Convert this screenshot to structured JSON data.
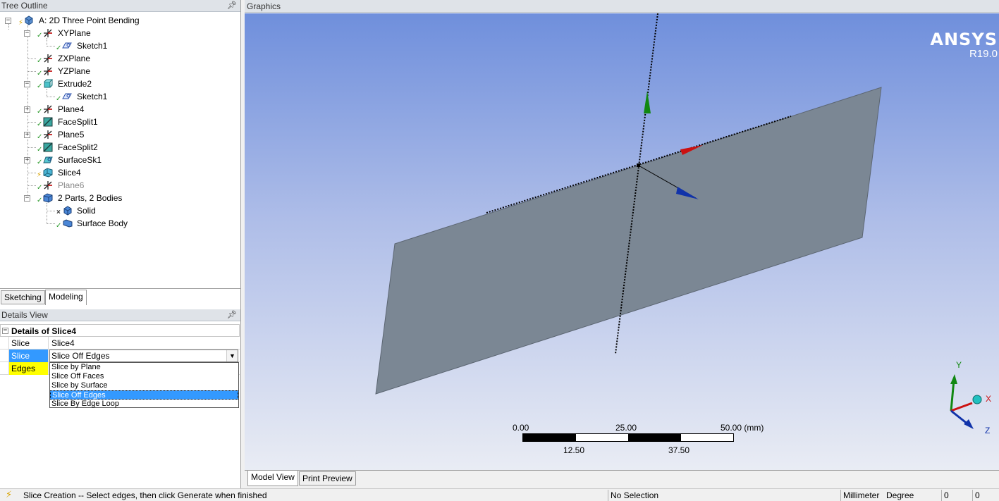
{
  "tree_outline": {
    "title": "Tree Outline",
    "items": [
      {
        "label": "A: 2D Three Point Bending",
        "icon": "model-icon",
        "status": "bolt"
      },
      {
        "label": "XYPlane",
        "icon": "plane-icon",
        "status": "check"
      },
      {
        "label": "Sketch1",
        "icon": "sketch-icon",
        "status": "check"
      },
      {
        "label": "ZXPlane",
        "icon": "plane-icon",
        "status": "check"
      },
      {
        "label": "YZPlane",
        "icon": "plane-icon",
        "status": "check"
      },
      {
        "label": "Extrude2",
        "icon": "extrude-icon",
        "status": "check"
      },
      {
        "label": "Sketch1",
        "icon": "sketch-icon",
        "status": "check"
      },
      {
        "label": "Plane4",
        "icon": "plane-icon",
        "status": "check"
      },
      {
        "label": "FaceSplit1",
        "icon": "facesplit-icon",
        "status": "check"
      },
      {
        "label": "Plane5",
        "icon": "plane-icon",
        "status": "check"
      },
      {
        "label": "FaceSplit2",
        "icon": "facesplit-icon",
        "status": "check"
      },
      {
        "label": "SurfaceSk1",
        "icon": "surface-sketch-icon",
        "status": "check"
      },
      {
        "label": "Slice4",
        "icon": "slice-icon",
        "status": "bolt"
      },
      {
        "label": "Plane6",
        "icon": "plane-icon",
        "status": "check"
      },
      {
        "label": "2 Parts, 2 Bodies",
        "icon": "parts-icon",
        "status": "check"
      },
      {
        "label": "Solid",
        "icon": "solid-body-icon",
        "status": "x"
      },
      {
        "label": "Surface Body",
        "icon": "surface-body-icon",
        "status": "check"
      }
    ]
  },
  "tabs": {
    "sketching": "Sketching",
    "modeling": "Modeling"
  },
  "details_view": {
    "title": "Details View",
    "section": "Details of Slice4",
    "rows": [
      {
        "key": "Slice",
        "value": "Slice4"
      },
      {
        "key": "Slice Type",
        "value": "Slice Off Edges"
      },
      {
        "key": "Edges",
        "value": ""
      }
    ],
    "dropdown_options": [
      "Slice by Plane",
      "Slice Off Faces",
      "Slice by Surface",
      "Slice Off Edges",
      "Slice By Edge Loop"
    ],
    "selected_option": "Slice Off Edges"
  },
  "graphics": {
    "title": "Graphics",
    "brand": "ANSYS",
    "version": "R19.0",
    "triad": {
      "x": "X",
      "y": "Y",
      "z": "Z"
    },
    "scale_bar": {
      "top_labels": [
        "0.00",
        "25.00",
        "50.00 (mm)"
      ],
      "bottom_labels": [
        "12.50",
        "37.50"
      ]
    }
  },
  "view_tabs": {
    "model_view": "Model View",
    "print_preview": "Print Preview"
  },
  "status_bar": {
    "message": "Slice Creation -- Select edges, then click Generate when finished",
    "selection": "No Selection",
    "units_length": "Millimeter",
    "units_angle": "Degree",
    "field1": "0",
    "field2": "0"
  },
  "colors": {
    "accent_selection": "#3399ff",
    "edges_highlight": "#ffff00",
    "surface_body": "#7b8794",
    "axis_x": "#cc1111",
    "axis_y": "#118811",
    "axis_z": "#1133aa"
  }
}
